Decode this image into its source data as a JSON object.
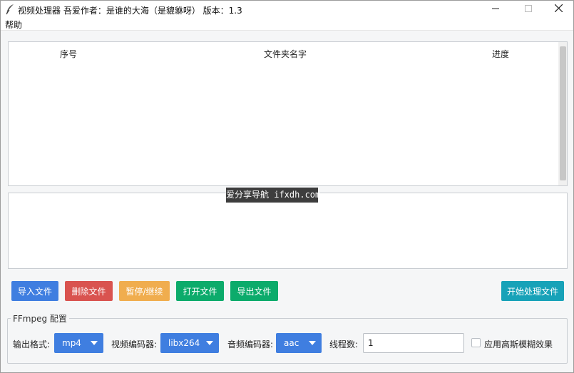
{
  "window": {
    "title": "视频处理器  吾爱作者：是谁的大海（是貔貅呀） 版本：1.3",
    "menu": [
      "帮助"
    ]
  },
  "file_table": {
    "columns": [
      "序号",
      "文件夹名字",
      "进度"
    ],
    "rows": []
  },
  "watermark": "爱分享导航 ifxdh.com",
  "actions": {
    "import": "导入文件",
    "delete": "删除文件",
    "pause": "暂停/继续",
    "open": "打开文件",
    "export": "导出文件",
    "start": "开始处理文件"
  },
  "config": {
    "group_title": "FFmpeg 配置",
    "output_format_label": "输出格式:",
    "output_format_value": "mp4",
    "video_codec_label": "视频编码器:",
    "video_codec_value": "libx264",
    "audio_codec_label": "音频编码器:",
    "audio_codec_value": "aac",
    "threads_label": "线程数:",
    "threads_value": "1",
    "blur_label": "应用高斯模糊效果",
    "blur_checked": false
  },
  "colors": {
    "primary": "#3f7ee0",
    "danger": "#d9534f",
    "warning": "#f0ad4e",
    "success": "#0cab6b",
    "info": "#17a2b8"
  },
  "icons": [
    "feather-icon",
    "minimize-icon",
    "maximize-icon",
    "close-icon",
    "dropdown-arrow-icon"
  ]
}
